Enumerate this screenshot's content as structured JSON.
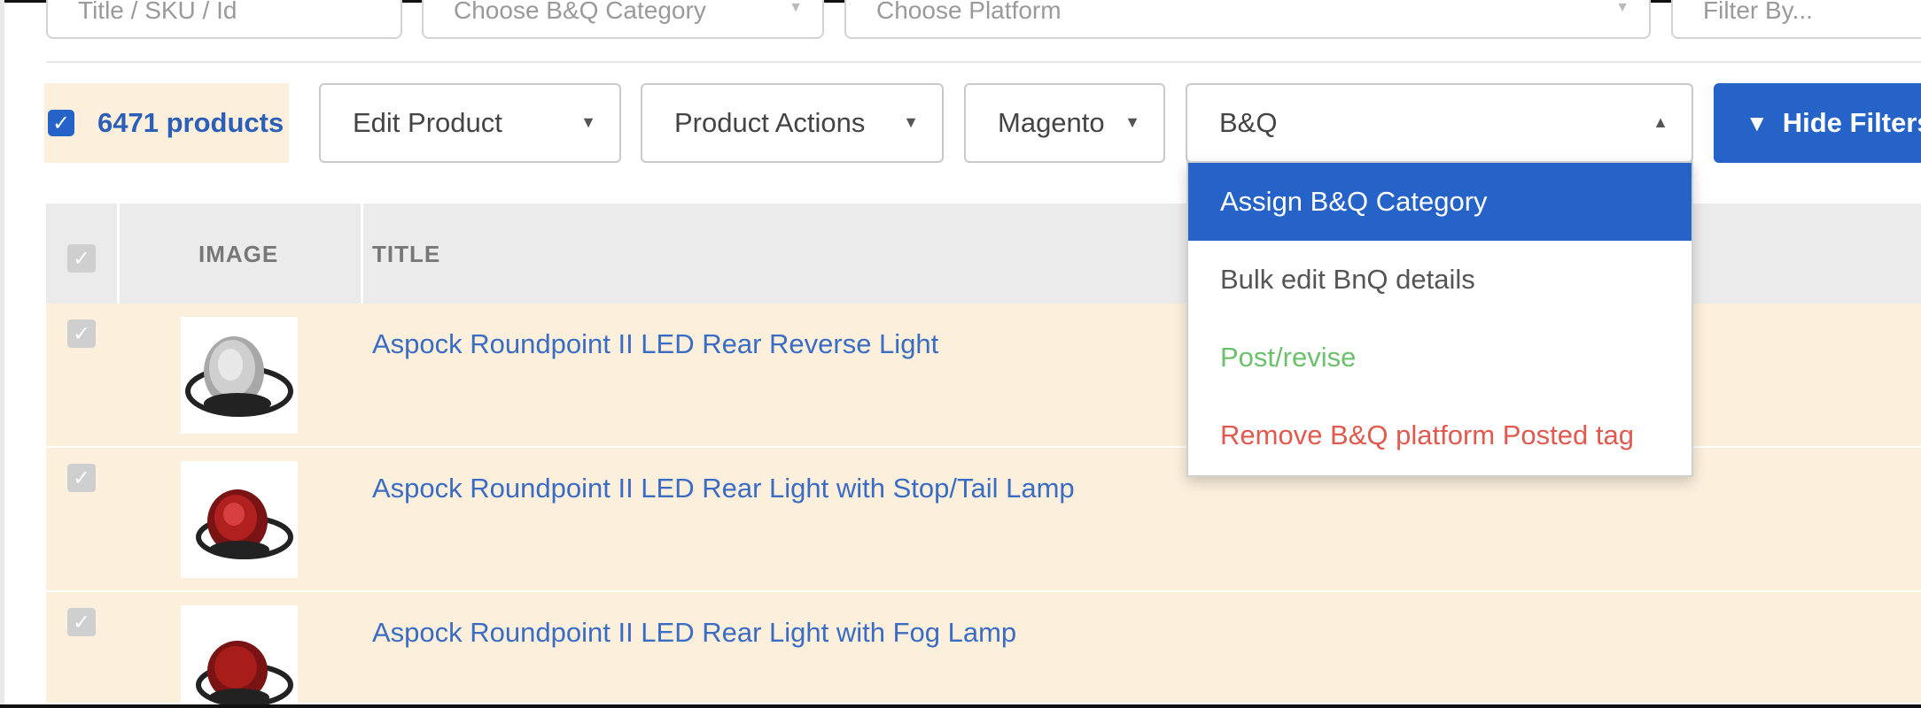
{
  "filters": {
    "title_sku_placeholder": "Title / SKU / Id",
    "category_placeholder": "Choose B&Q Category",
    "platform_placeholder": "Choose Platform",
    "filter_by_placeholder": "Filter By..."
  },
  "toolbar": {
    "selected_count": "6471 products",
    "edit_product": "Edit Product",
    "product_actions": "Product Actions",
    "magento": "Magento",
    "bnq": "B&Q",
    "hide_filters": "Hide Filters"
  },
  "menu": {
    "items": [
      {
        "label": "Assign B&Q Category",
        "color": "#ffffff"
      },
      {
        "label": "Bulk edit BnQ details",
        "color": "#555555"
      },
      {
        "label": "Post/revise",
        "color": "#6cc06c"
      },
      {
        "label": "Remove B&Q platform Posted tag",
        "color": "#e05a4f"
      }
    ]
  },
  "table": {
    "columns": {
      "image": "IMAGE",
      "title": "TITLE"
    },
    "rows": [
      {
        "title": "Aspock Roundpoint II LED Rear Reverse Light",
        "thumb": "clear-lens"
      },
      {
        "title": "Aspock Roundpoint II LED Rear Light with Stop/Tail Lamp",
        "thumb": "red-lens"
      },
      {
        "title": "Aspock Roundpoint II LED Rear Light with Fog Lamp",
        "thumb": "red-lens"
      }
    ]
  },
  "colors": {
    "accent": "#2563c9",
    "row_highlight": "#fcefdc",
    "link": "#3a6cc4"
  }
}
